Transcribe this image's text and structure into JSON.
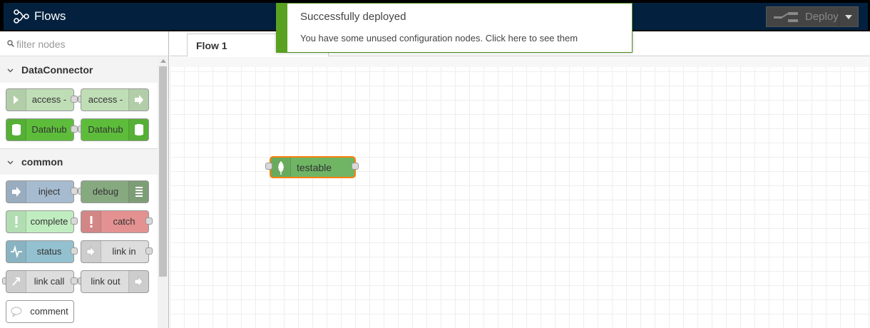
{
  "header": {
    "title": "Flows",
    "deploy_label": "Deploy"
  },
  "palette": {
    "search_placeholder": "filter nodes",
    "categories": [
      {
        "name": "DataConnector",
        "nodes": [
          {
            "label": "access -",
            "color": "#c0deb6"
          },
          {
            "label": "access -",
            "color": "#c0deb6"
          },
          {
            "label": "Datahub",
            "color": "#5dbd3b"
          },
          {
            "label": "Datahub",
            "color": "#5dbd3b"
          }
        ]
      },
      {
        "name": "common",
        "nodes": [
          {
            "label": "inject",
            "color": "#a6bbcf"
          },
          {
            "label": "debug",
            "color": "#87a980"
          },
          {
            "label": "complete",
            "color": "#c0edc0"
          },
          {
            "label": "catch",
            "color": "#e49191"
          },
          {
            "label": "status",
            "color": "#94c1d0"
          },
          {
            "label": "link in",
            "color": "#dddddd"
          },
          {
            "label": "link call",
            "color": "#dddddd"
          },
          {
            "label": "link out",
            "color": "#dddddd"
          },
          {
            "label": "comment",
            "color": "#ffffff"
          }
        ]
      }
    ]
  },
  "workspace": {
    "tabs": [
      {
        "label": "Flow 1"
      }
    ],
    "node": {
      "label": "testable",
      "color": "#6fb564",
      "selected_border": "#ff7f0e"
    }
  },
  "notification": {
    "title": "Successfully deployed",
    "message": "You have some unused configuration nodes. Click here to see them",
    "accent": "#5aa121"
  }
}
